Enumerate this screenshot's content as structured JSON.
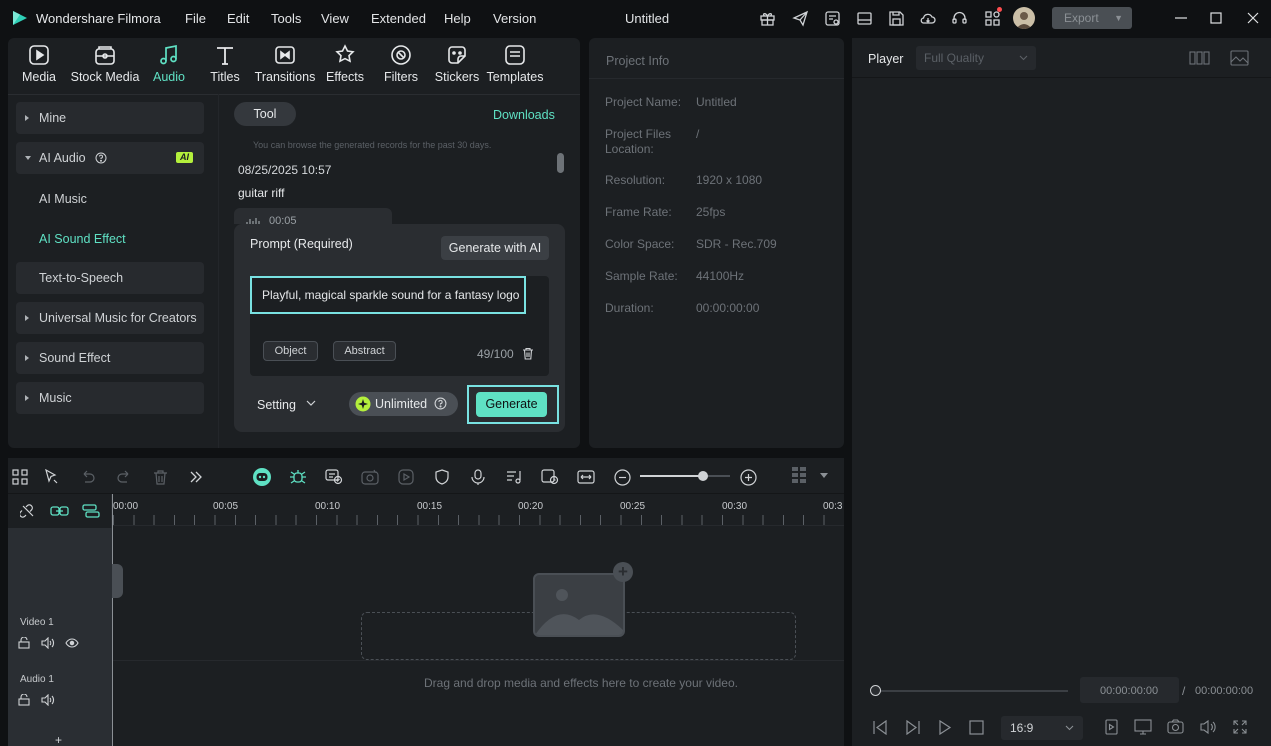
{
  "app": {
    "name": "Wondershare Filmora",
    "project_title": "Untitled"
  },
  "menu": [
    "File",
    "Edit",
    "Tools",
    "View",
    "Extended",
    "Help",
    "Version"
  ],
  "header": {
    "export_label": "Export"
  },
  "tabs": [
    {
      "label": "Media",
      "icon": "media-icon"
    },
    {
      "label": "Stock Media",
      "icon": "stock-media-icon"
    },
    {
      "label": "Audio",
      "icon": "audio-icon",
      "active": true
    },
    {
      "label": "Titles",
      "icon": "titles-icon"
    },
    {
      "label": "Transitions",
      "icon": "transitions-icon"
    },
    {
      "label": "Effects",
      "icon": "effects-icon"
    },
    {
      "label": "Filters",
      "icon": "filters-icon"
    },
    {
      "label": "Stickers",
      "icon": "stickers-icon"
    },
    {
      "label": "Templates",
      "icon": "templates-icon"
    }
  ],
  "sidebar": {
    "mine": "Mine",
    "ai_audio": "AI Audio",
    "ai_badge": "AI",
    "ai_music": "AI Music",
    "ai_sound_effect": "AI Sound Effect",
    "text_to_speech": "Text-to-Speech",
    "universal_music": "Universal Music for Creators",
    "sound_effect": "Sound Effect",
    "music": "Music"
  },
  "tool_panel": {
    "tool_tab": "Tool",
    "downloads": "Downloads",
    "notice": "You can browse the generated records for the past 30 days.",
    "record_date": "08/25/2025 10:57",
    "record_title": "guitar riff",
    "record_duration": "00:05"
  },
  "prompt": {
    "label": "Prompt (Required)",
    "generate_with_ai": "Generate with AI",
    "value": "Playful, magical sparkle sound for a fantasy logo",
    "tags": [
      "Object",
      "Abstract"
    ],
    "char_count": "49/100",
    "setting": "Setting",
    "unlimited": "Unlimited",
    "generate": "Generate"
  },
  "project_info": {
    "title": "Project Info",
    "rows": [
      {
        "key": "Project Name:",
        "value": "Untitled"
      },
      {
        "key": "Project Files Location:",
        "value": "/"
      },
      {
        "key": "Resolution:",
        "value": "1920 x 1080"
      },
      {
        "key": "Frame Rate:",
        "value": "25fps"
      },
      {
        "key": "Color Space:",
        "value": "SDR - Rec.709"
      },
      {
        "key": "Sample Rate:",
        "value": "44100Hz"
      },
      {
        "key": "Duration:",
        "value": "00:00:00:00"
      }
    ]
  },
  "player": {
    "label": "Player",
    "quality": "Full Quality",
    "current_time": "00:00:00:00",
    "separator": "/",
    "total_time": "00:00:00:00",
    "aspect": "16:9"
  },
  "timeline": {
    "ruler": [
      "00:00",
      "00:05",
      "00:10",
      "00:15",
      "00:20",
      "00:25",
      "00:30",
      "00:3"
    ],
    "tracks": {
      "video": "Video 1",
      "audio": "Audio 1"
    },
    "drop_hint": "Drag and drop media and effects here to create your video.",
    "zoom": 0.7
  },
  "colors": {
    "accent": "#5fe1c4",
    "panel": "#1c1f22",
    "background": "#0f1113"
  }
}
